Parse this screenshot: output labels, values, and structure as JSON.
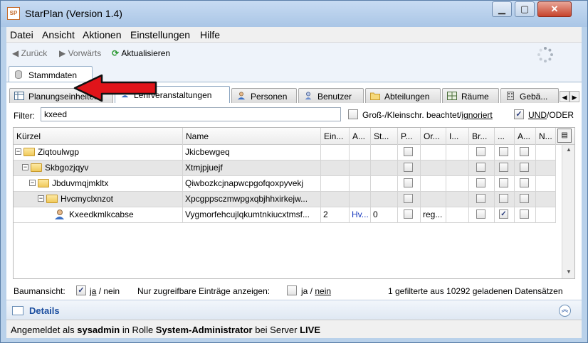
{
  "window": {
    "title": "StarPlan (Version 1.4)",
    "app_icon_text": "SP",
    "minimize_glyph": "▁",
    "maximize_glyph": "▢",
    "close_glyph": "✕"
  },
  "menubar": {
    "items": [
      "Datei",
      "Ansicht",
      "Aktionen",
      "Einstellungen",
      "Hilfe"
    ]
  },
  "toolbar": {
    "back_label": "Zurück",
    "forward_label": "Vorwärts",
    "refresh_label": "Aktualisieren"
  },
  "main_tab": {
    "label": "Stammdaten"
  },
  "sub_tabs": [
    {
      "label": "Planungseinheiten",
      "icon": "table-icon"
    },
    {
      "label": "Lehrveranstaltungen",
      "icon": "person-icon",
      "selected": true
    },
    {
      "label": "Personen",
      "icon": "person-icon"
    },
    {
      "label": "Benutzer",
      "icon": "user-icon"
    },
    {
      "label": "Abteilungen",
      "icon": "folder-icon"
    },
    {
      "label": "Räume",
      "icon": "room-icon"
    },
    {
      "label": "Gebä...",
      "icon": "building-icon"
    }
  ],
  "filter": {
    "label": "Filter:",
    "value": "kxeed",
    "case_label_pre": "Groß-/Kleinschr. beachtet/",
    "case_label_link": "ignoriert",
    "case_checked": false,
    "und_label": "UND",
    "oder_label": "/ODER",
    "und_checked": true
  },
  "grid": {
    "columns": [
      "Kürzel",
      "Name",
      "Ein...",
      "A...",
      "St...",
      "P...",
      "Or...",
      "I...",
      "Br...",
      "...",
      "A...",
      "N..."
    ],
    "rows": [
      {
        "level": 0,
        "type": "folder",
        "kuerzel": "Ziqtoulwgp",
        "name": "Jkicbewgeq",
        "ein": "",
        "a": "",
        "st": "",
        "or": "",
        "cb": [
          false,
          false,
          false,
          false
        ]
      },
      {
        "level": 1,
        "type": "folder",
        "kuerzel": "Skbgozjqyv",
        "name": "Xtmjpjuejf",
        "ein": "",
        "a": "",
        "st": "",
        "or": "",
        "cb": [
          false,
          false,
          false,
          false
        ]
      },
      {
        "level": 2,
        "type": "folder",
        "kuerzel": "Jbduvmqjmkltx",
        "name": "Qiwbozkcjnapwcpgofqoxpyvekj",
        "ein": "",
        "a": "",
        "st": "",
        "or": "",
        "cb": [
          false,
          false,
          false,
          false
        ]
      },
      {
        "level": 3,
        "type": "folder",
        "kuerzel": "Hvcmyclxnzot",
        "name": "Xpcgppsczmwpgxqbjhhxirkejw...",
        "ein": "",
        "a": "",
        "st": "",
        "or": "",
        "cb": [
          false,
          false,
          false,
          false
        ]
      },
      {
        "level": 4,
        "type": "person",
        "kuerzel": "Kxeedkmlkcabse",
        "name": "Vygmorfehcujlqkumtnkiucxtmsf...",
        "ein": "2",
        "a": "Hv...",
        "st": "0",
        "or": "reg...",
        "cb": [
          false,
          false,
          true,
          false
        ]
      }
    ],
    "menu_glyph": "▤"
  },
  "bottom": {
    "tree_label": "Baumansicht:",
    "tree_ja": "ja",
    "tree_sep": "/ nein",
    "tree_checked": true,
    "access_label": "Nur zugreifbare Einträge anzeigen:",
    "access_ja": "ja /",
    "access_nein": "nein",
    "access_checked": false,
    "count_text": "1 gefilterte aus 10292 geladenen Datensätzen"
  },
  "details": {
    "label": "Details",
    "collapse_glyph": "︽"
  },
  "status": {
    "prefix": "Angemeldet als ",
    "user": "sysadmin",
    "mid": " in Rolle ",
    "role": "System-Administrator",
    "mid2": " bei Server ",
    "server": "LIVE"
  },
  "colors": {
    "accent": "#1d4fa0",
    "annotation_arrow": "#e0141a"
  }
}
